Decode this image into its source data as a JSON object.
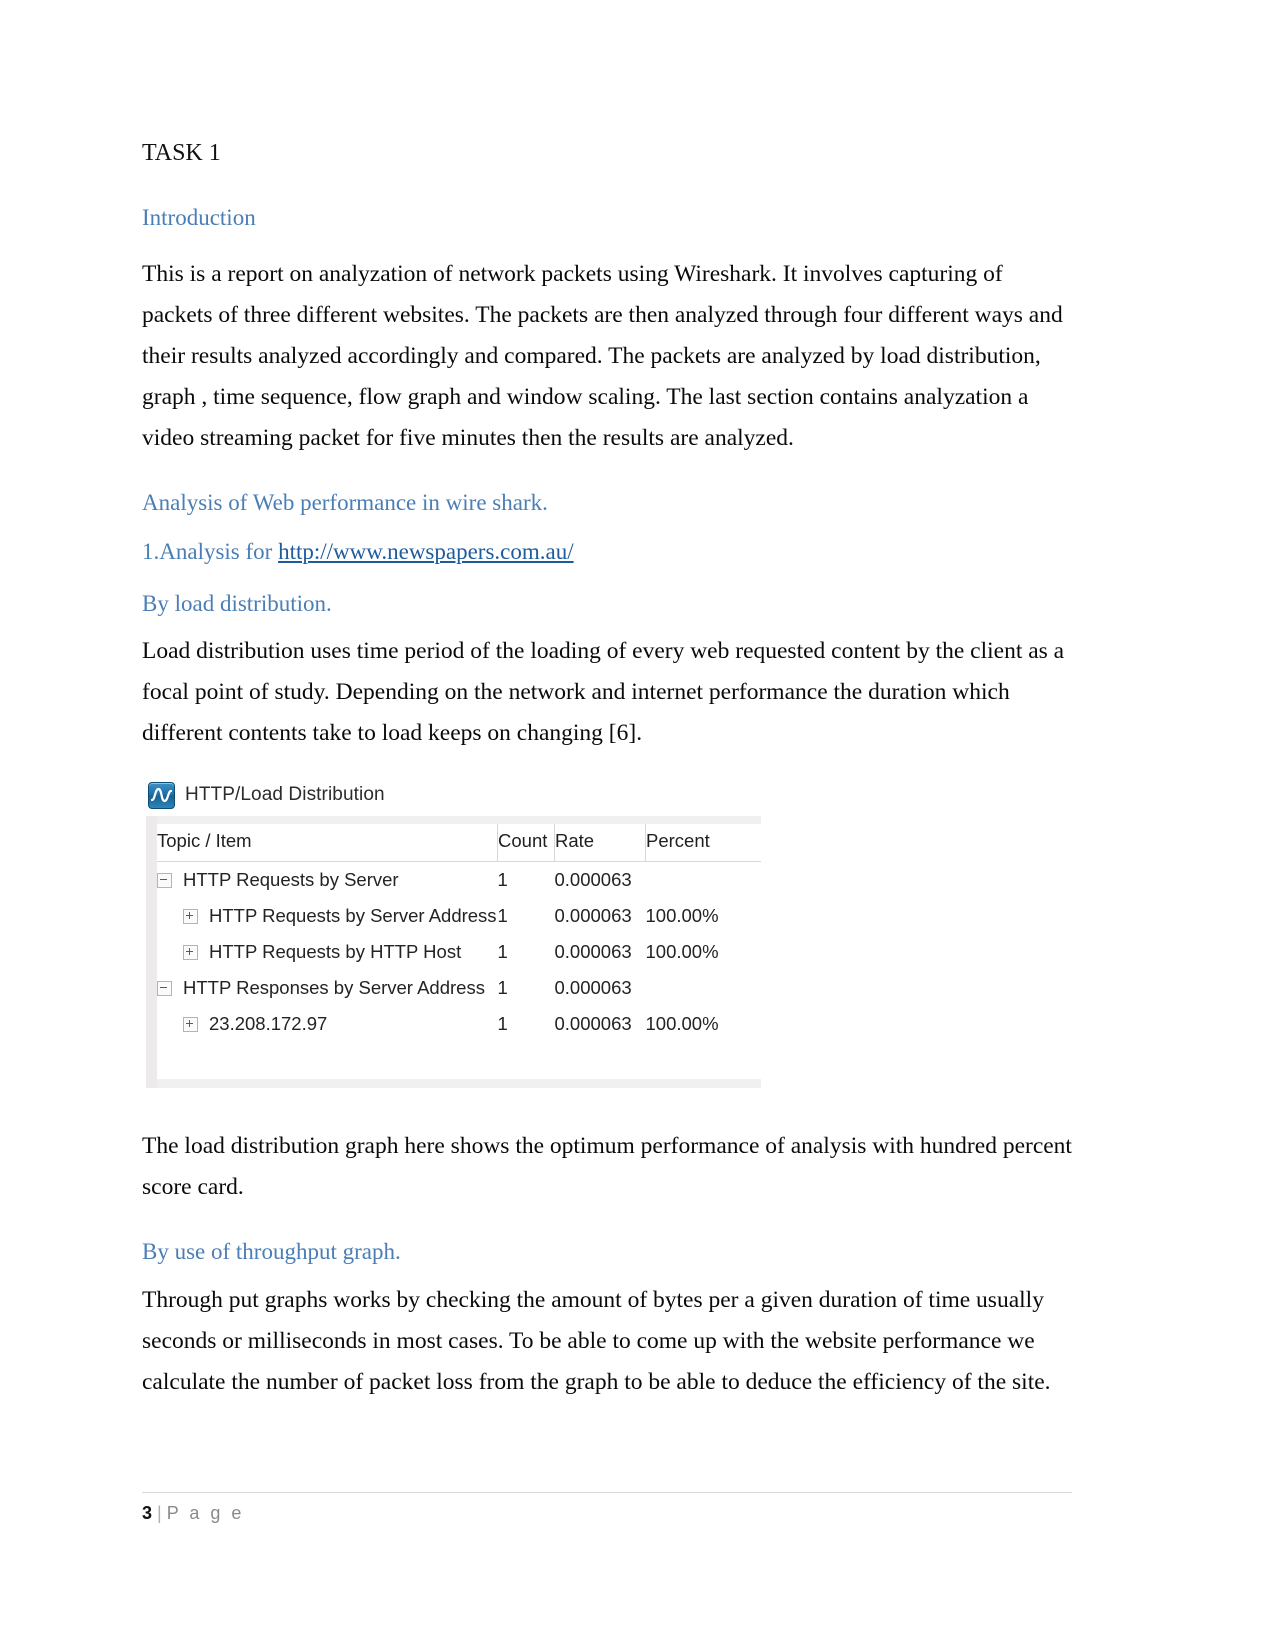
{
  "document": {
    "task_title": "TASK 1",
    "headings": {
      "introduction": "Introduction",
      "analysis_web_performance": "Analysis of Web performance in wire shark.",
      "by_load_distribution": "By load distribution.",
      "by_throughput_graph": "By use of throughput graph."
    },
    "paragraphs": {
      "intro": "This is a report on analyzation of network packets using Wireshark. It involves capturing of packets of three different websites. The packets are then analyzed through four different ways and their results analyzed accordingly and compared. The packets are analyzed by load distribution, graph   , time sequence, flow graph and window scaling. The last section contains analyzation a video streaming packet for five minutes then the results are analyzed.",
      "load_distribution": "Load distribution uses time period of the loading of every web requested content by the client as a focal point of study. Depending on the network and internet performance the duration which different contents take to load keeps on changing [6].",
      "after_figure": "The load distribution graph here shows the optimum performance of analysis with hundred percent score card.",
      "throughput": "Through put graphs works by checking the amount of bytes per a given duration of time usually seconds or milliseconds in most cases. To be able to come up with the website performance we calculate the number of packet loss from the graph to be able to deduce the efficiency of the site."
    },
    "analysis_item": {
      "prefix": "1.Analysis for ",
      "link_text": "http://www.newspapers.com.au/"
    }
  },
  "figure": {
    "window_title": "HTTP/Load Distribution",
    "icon": "wireshark-icon",
    "table": {
      "headers": [
        "Topic / Item",
        "Count",
        "Rate",
        "Percent"
      ],
      "rows": [
        {
          "toggle": "minus",
          "indent": 0,
          "topic": "HTTP Requests by Server",
          "count": "1",
          "rate": "0.000063",
          "percent": ""
        },
        {
          "toggle": "plus",
          "indent": 1,
          "topic": "HTTP Requests by Server Address",
          "count": "1",
          "rate": "0.000063",
          "percent": "100.00%"
        },
        {
          "toggle": "plus",
          "indent": 1,
          "topic": "HTTP Requests by HTTP Host",
          "count": "1",
          "rate": "0.000063",
          "percent": "100.00%"
        },
        {
          "toggle": "minus",
          "indent": 0,
          "topic": "HTTP Responses by Server Address",
          "count": "1",
          "rate": "0.000063",
          "percent": ""
        },
        {
          "toggle": "plus",
          "indent": 1,
          "topic": "23.208.172.97",
          "count": "1",
          "rate": "0.000063",
          "percent": "100.00%"
        }
      ]
    }
  },
  "footer": {
    "page_number": "3",
    "separator": "|",
    "page_word": "P a g e"
  },
  "colors": {
    "heading_blue": "#4a7eb5",
    "link_blue": "#1f5c9e",
    "body_text": "#0a0a0a",
    "footer_grey": "#8a8a8a"
  }
}
